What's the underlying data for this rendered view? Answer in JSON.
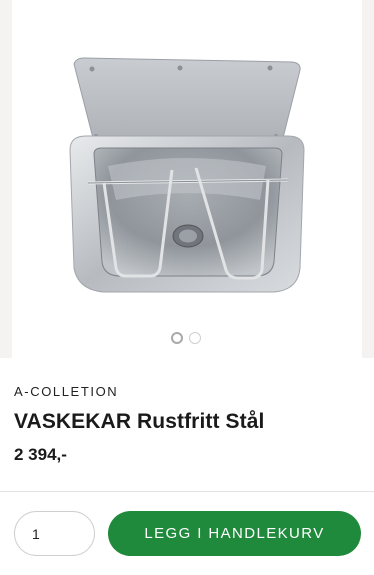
{
  "product": {
    "brand": "A-COLLETION",
    "title": "VASKEKAR Rustfritt Stål",
    "price": "2 394,-",
    "image_subject": "stainless-steel-utility-sink"
  },
  "gallery": {
    "slides": 2,
    "active_slide": 1
  },
  "cart": {
    "quantity": "1",
    "add_label": "LEGG I HANDLEKURV"
  },
  "colors": {
    "accent": "#1f8a3c"
  }
}
